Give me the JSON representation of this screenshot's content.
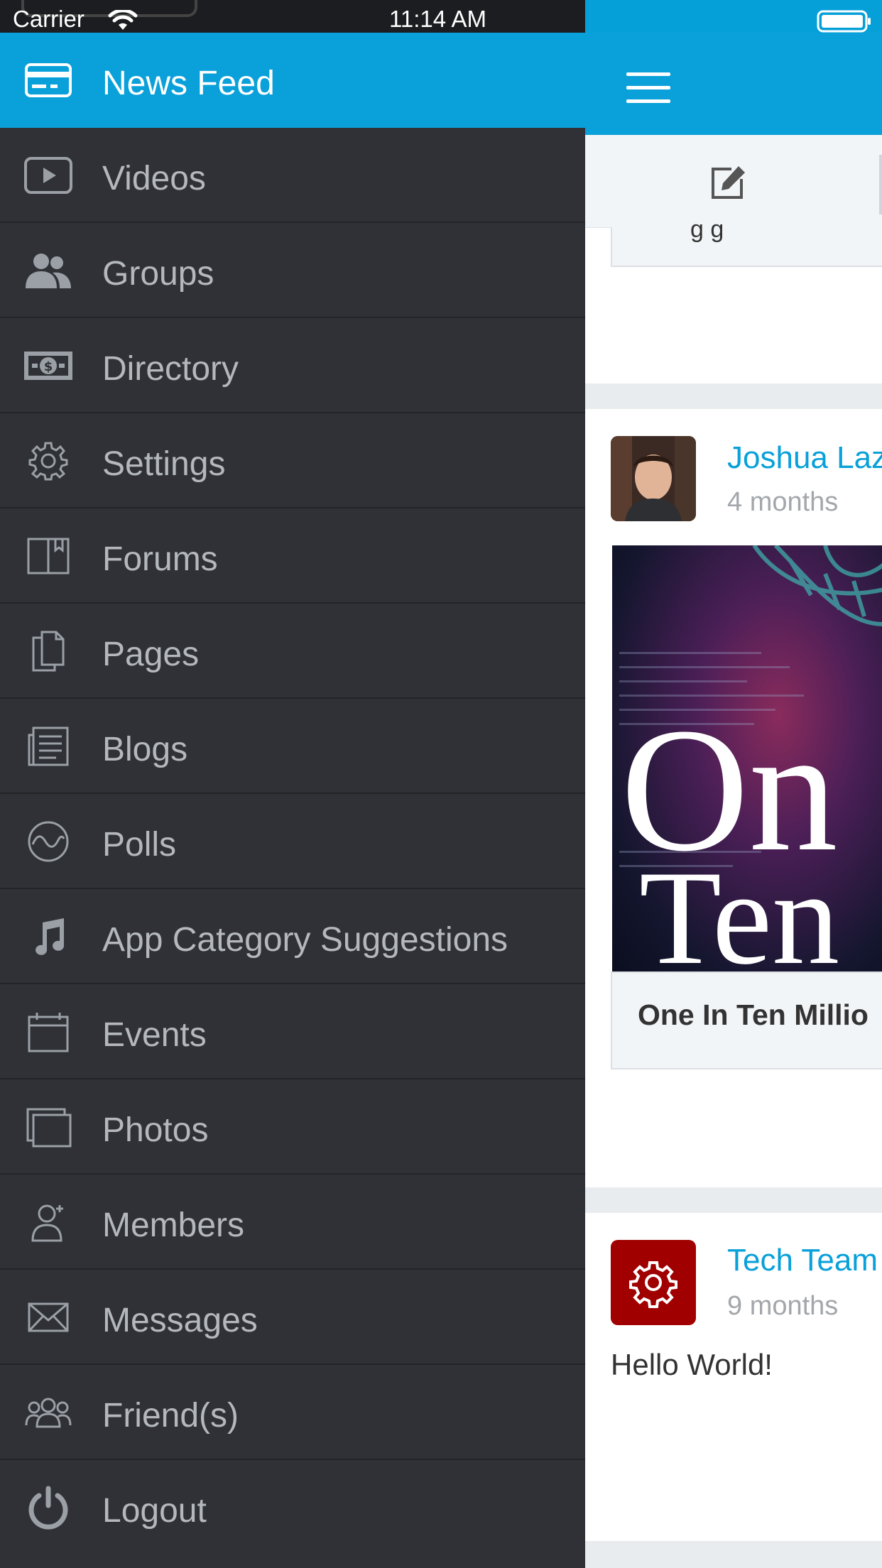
{
  "status_bar": {
    "carrier": "Carrier",
    "time": "11:14 AM"
  },
  "drawer": {
    "items": [
      {
        "label": "News Feed",
        "icon": "news-feed-icon",
        "active": true
      },
      {
        "label": "Videos",
        "icon": "video-icon"
      },
      {
        "label": "Groups",
        "icon": "groups-icon"
      },
      {
        "label": "Directory",
        "icon": "money-icon"
      },
      {
        "label": "Settings",
        "icon": "gear-icon"
      },
      {
        "label": "Forums",
        "icon": "book-icon"
      },
      {
        "label": "Pages",
        "icon": "pages-icon"
      },
      {
        "label": "Blogs",
        "icon": "blog-icon"
      },
      {
        "label": "Polls",
        "icon": "pulse-icon"
      },
      {
        "label": "App Category Suggestions",
        "icon": "music-note-icon"
      },
      {
        "label": "Events",
        "icon": "calendar-icon"
      },
      {
        "label": "Photos",
        "icon": "photos-icon"
      },
      {
        "label": "Members",
        "icon": "member-icon"
      },
      {
        "label": "Messages",
        "icon": "envelope-icon"
      },
      {
        "label": "Friend(s)",
        "icon": "friends-icon"
      },
      {
        "label": "Logout",
        "icon": "power-icon"
      }
    ]
  },
  "feed": {
    "prev_text": "g g",
    "post1": {
      "author": "Joshua Laz",
      "time": "4 months",
      "image_text_line1": "On",
      "image_text_line2": "Ten",
      "link_title": "One In Ten Millio"
    },
    "post2": {
      "author": "Tech Team",
      "time": "9 months",
      "text": "Hello World!"
    }
  },
  "colors": {
    "brand": "#0aa0d9",
    "drawer_bg": "#2f3136",
    "menu_text": "#b4b8bd",
    "avatar_red": "#a00000"
  }
}
